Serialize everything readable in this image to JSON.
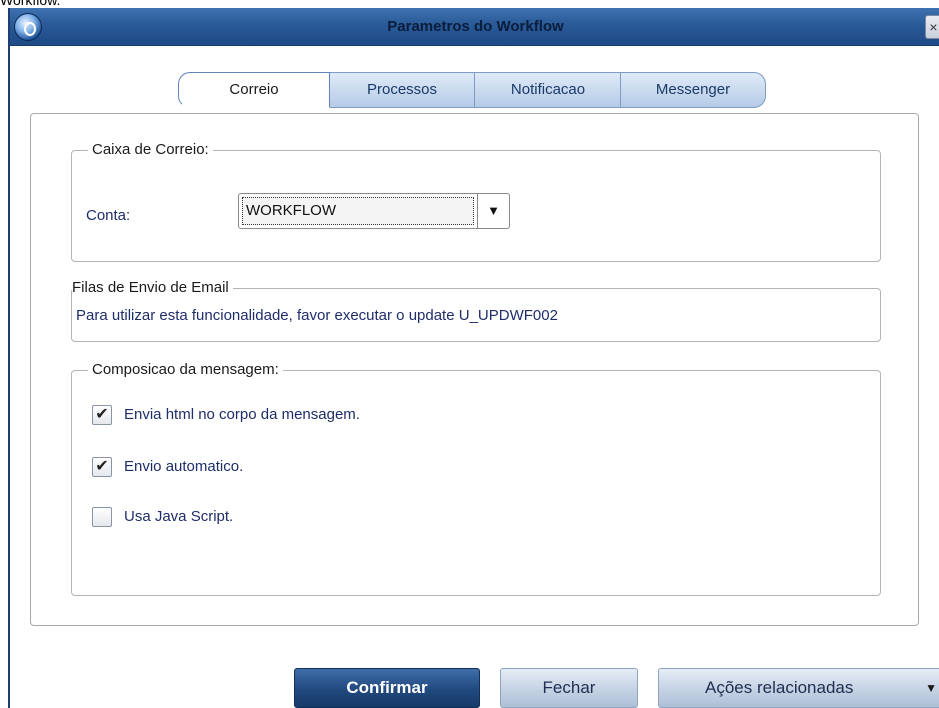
{
  "page": {
    "caption": "Workflow."
  },
  "window": {
    "title": "Parametros do Workflow",
    "close_label": "×"
  },
  "tabs": [
    {
      "label": "Correio",
      "active": true
    },
    {
      "label": "Processos",
      "active": false
    },
    {
      "label": "Notificacao",
      "active": false
    },
    {
      "label": "Messenger",
      "active": false
    }
  ],
  "mailbox": {
    "legend": "Caixa de Correio:",
    "account_label": "Conta:",
    "account_value": "WORKFLOW",
    "dropdown_arrow": "▼"
  },
  "email_queue": {
    "legend": "Filas de Envio de Email",
    "message": "Para utilizar esta funcionalidade, favor executar o update U_UPDWF002"
  },
  "composition": {
    "legend": "Composicao da mensagem:",
    "options": [
      {
        "label": "Envia html no corpo da mensagem.",
        "checked": true,
        "mark": "✔"
      },
      {
        "label": "Envio automatico.",
        "checked": true,
        "mark": "✔"
      },
      {
        "label": "Usa Java Script.",
        "checked": false,
        "mark": ""
      }
    ]
  },
  "footer": {
    "confirm_label": "Confirmar",
    "close_label": "Fechar",
    "actions_label": "Ações relacionadas",
    "actions_arrow": "▼"
  },
  "colors": {
    "titlebar": "#2a5a98",
    "primary_button": "#21497e",
    "label_text": "#1f2d6b"
  }
}
